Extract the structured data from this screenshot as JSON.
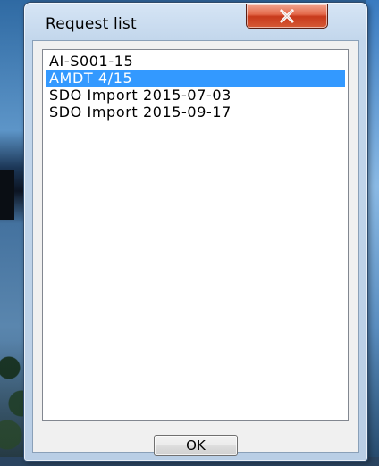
{
  "window": {
    "title": "Request list"
  },
  "title_bar": {
    "close_icon": "close-icon",
    "close_button_color": "#c8391b"
  },
  "request_list": {
    "items": [
      {
        "label": "AI-S001-15",
        "selected": false
      },
      {
        "label": "AMDT 4/15",
        "selected": true
      },
      {
        "label": "SDO Import 2015-07-03",
        "selected": false
      },
      {
        "label": "SDO Import 2015-09-17",
        "selected": false
      }
    ],
    "selection_color": "#3399ff"
  },
  "buttons": {
    "ok_label": "OK"
  }
}
